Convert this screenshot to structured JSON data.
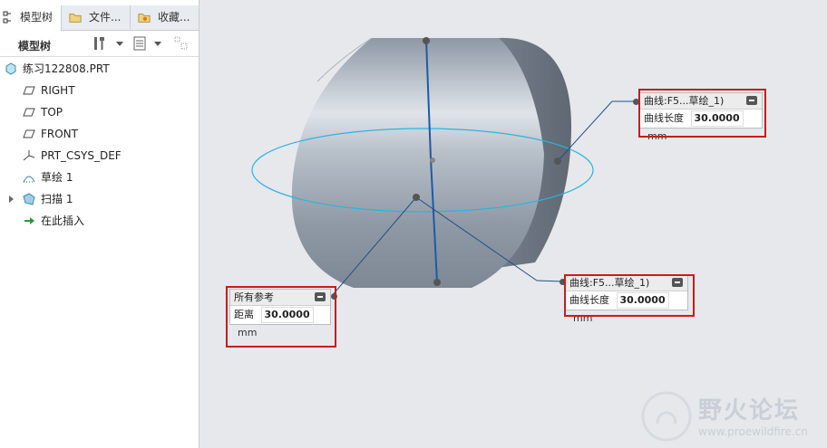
{
  "tabs": [
    {
      "label": "模型树",
      "icon": "model-tree-icon"
    },
    {
      "label": "文件...",
      "icon": "folder-icon"
    },
    {
      "label": "收藏...",
      "icon": "favorites-icon"
    }
  ],
  "toolbar": {
    "title": "模型树",
    "icons": [
      "settings-tools-icon",
      "show-options-icon",
      "filter-icon"
    ]
  },
  "tree": [
    {
      "label": "练习122808.PRT",
      "icon": "part-icon"
    },
    {
      "label": "RIGHT",
      "icon": "datum-plane-icon"
    },
    {
      "label": "TOP",
      "icon": "datum-plane-icon"
    },
    {
      "label": "FRONT",
      "icon": "datum-plane-icon"
    },
    {
      "label": "PRT_CSYS_DEF",
      "icon": "csys-icon"
    },
    {
      "label": "草绘 1",
      "icon": "sketch-icon"
    },
    {
      "label": "扫描 1",
      "icon": "sweep-icon"
    },
    {
      "label": "在此插入",
      "icon": "insert-arrow-icon"
    }
  ],
  "callouts": [
    {
      "header": "曲线:F5...草绘_1)",
      "label": "曲线长度",
      "value": "30.0000",
      "unit": "mm"
    },
    {
      "header": "曲线:F5...草绘_1)",
      "label": "曲线长度",
      "value": "30.0000",
      "unit": "mm"
    },
    {
      "header": "所有参考",
      "label": "距离",
      "value": "30.0000",
      "unit": "mm"
    }
  ],
  "watermark": {
    "text": "野火论坛",
    "url": "www.proewildfire.cn"
  },
  "colors": {
    "highlight": "#cc1b1b",
    "curve": "#2bb4e0",
    "model": "#9aa3ad"
  }
}
